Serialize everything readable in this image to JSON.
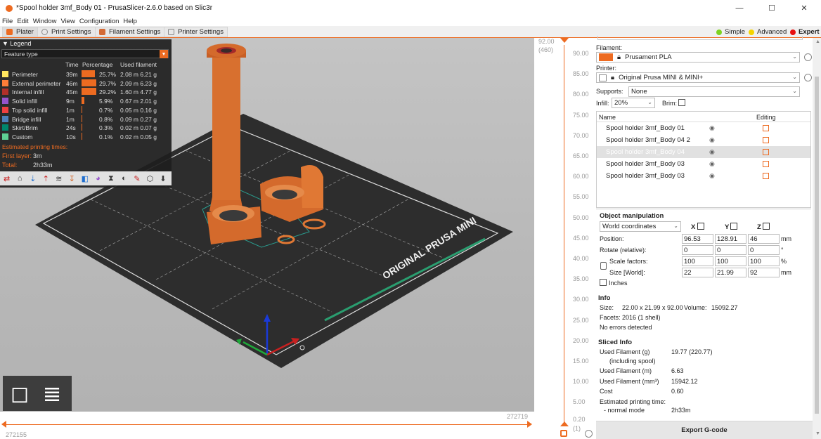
{
  "window": {
    "title": "*Spool holder 3mf_Body 01 - PrusaSlicer-2.6.0 based on Slic3r",
    "minimize": "—",
    "maximize": "☐",
    "close": "✕"
  },
  "menu": [
    "File",
    "Edit",
    "Window",
    "View",
    "Configuration",
    "Help"
  ],
  "tabs": [
    {
      "label": "Plater"
    },
    {
      "label": "Print Settings"
    },
    {
      "label": "Filament Settings"
    },
    {
      "label": "Printer Settings"
    }
  ],
  "modes": [
    {
      "label": "Simple",
      "color": "#7ed321"
    },
    {
      "label": "Advanced",
      "color": "#f5d400"
    },
    {
      "label": "Expert",
      "color": "#e81010"
    }
  ],
  "legend": {
    "title": "Legend",
    "view_type": "Feature type",
    "col_time": "Time",
    "col_percentage": "Percentage",
    "col_used": "Used filament",
    "rows": [
      {
        "name": "Perimeter",
        "time": "39m",
        "pct": "25.7%",
        "frac": 0.257,
        "used": "2.08 m  6.21 g",
        "color": "#ffe65f"
      },
      {
        "name": "External perimeter",
        "time": "46m",
        "pct": "29.7%",
        "frac": 0.297,
        "used": "2.09 m  6.23 g",
        "color": "#ff7d38"
      },
      {
        "name": "Internal infill",
        "time": "45m",
        "pct": "29.2%",
        "frac": 0.292,
        "used": "1.60 m  4.77 g",
        "color": "#b03029"
      },
      {
        "name": "Solid infill",
        "time": "9m",
        "pct": "5.9%",
        "frac": 0.059,
        "used": "0.67 m  2.01 g",
        "color": "#9654cc"
      },
      {
        "name": "Top solid infill",
        "time": "1m",
        "pct": "0.7%",
        "frac": 0.007,
        "used": "0.05 m  0.16 g",
        "color": "#f04040"
      },
      {
        "name": "Bridge infill",
        "time": "1m",
        "pct": "0.8%",
        "frac": 0.008,
        "used": "0.09 m  0.27 g",
        "color": "#4d80ba"
      },
      {
        "name": "Skirt/Brim",
        "time": "24s",
        "pct": "0.3%",
        "frac": 0.003,
        "used": "0.02 m  0.07 g",
        "color": "#00876e"
      },
      {
        "name": "Custom",
        "time": "10s",
        "pct": "0.1%",
        "frac": 0.001,
        "used": "0.02 m  0.05 g",
        "color": "#5ed194"
      }
    ],
    "est_label": "Estimated printing times:",
    "first_layer_label": "First layer:",
    "first_layer": "3m",
    "total_label": "Total:",
    "total": "2h33m"
  },
  "vertical_slider": {
    "top_height": "92.00",
    "top_layer": "(460)",
    "bottom_height": "0.20",
    "bottom_layer": "(1)",
    "ticks": [
      "90.00",
      "85.00",
      "80.00",
      "75.00",
      "70.00",
      "65.00",
      "60.00",
      "55.00",
      "50.00",
      "45.00",
      "40.00",
      "35.00",
      "30.00",
      "25.00",
      "20.00",
      "15.00",
      "10.00",
      "5.00"
    ]
  },
  "horizontal_slider": {
    "right_value": "272719",
    "left_value": "272155"
  },
  "bed_label": "ORIGINAL PRUSA MINI",
  "sidebar": {
    "filament_label": "Filament:",
    "filament": "Prusament PLA",
    "filament_color": "#ed6b21",
    "printer_label": "Printer:",
    "printer": "Original Prusa MINI & MINI+",
    "supports_label": "Supports:",
    "supports": "None",
    "infill_label": "Infill:",
    "infill": "20%",
    "brim_label": "Brim:",
    "objects_col_name": "Name",
    "objects_col_editing": "Editing",
    "objects": [
      "Spool holder 3mf_Body 01",
      "Spool holder 3mf_Body 04 2",
      "Spool holder 3mf_Body 04",
      "Spool holder 3mf_Body 03",
      "Spool holder 3mf_Body 03"
    ],
    "manip_title": "Object manipulation",
    "coords": "World coordinates",
    "axis_x": "X",
    "axis_y": "Y",
    "axis_z": "Z",
    "position_label": "Position:",
    "position": [
      "96.53",
      "128.91",
      "46"
    ],
    "position_unit": "mm",
    "rotate_label": "Rotate (relative):",
    "rotate": [
      "0",
      "0",
      "0"
    ],
    "rotate_unit": "°",
    "scale_label": "Scale factors:",
    "scale": [
      "100",
      "100",
      "100"
    ],
    "scale_unit": "%",
    "size_label": "Size [World]:",
    "size": [
      "22",
      "21.99",
      "92"
    ],
    "size_unit": "mm",
    "inches_label": "Inches",
    "info_title": "Info",
    "info_size_label": "Size:",
    "info_size": "22.00 x 21.99 x 92.00",
    "info_volume_label": "Volume:",
    "info_volume": "15092.27",
    "facets_label": "Facets:",
    "facets": "2016 (1 shell)",
    "errors": "No errors detected",
    "sliced_title": "Sliced Info",
    "uf_g_label": "Used Filament (g)",
    "uf_g": "19.77 (220.77)",
    "uf_g_sub": "(including spool)",
    "uf_m_label": "Used Filament (m)",
    "uf_m": "6.63",
    "uf_mm3_label": "Used Filament (mm³)",
    "uf_mm3": "15942.12",
    "cost_label": "Cost",
    "cost": "0.60",
    "ept_label": "Estimated printing time:",
    "normal_label": "- normal mode",
    "normal": "2h33m",
    "export_label": "Export G-code"
  }
}
